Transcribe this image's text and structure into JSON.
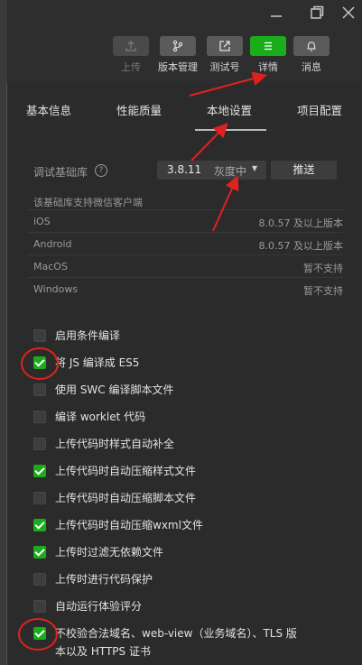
{
  "window": {
    "minimize_icon": "minimize-icon",
    "maximize_icon": "maximize-icon",
    "close_icon": "close-icon"
  },
  "toolbar": {
    "upload": "上传",
    "version": "版本管理",
    "test": "测试号",
    "detail": "详情",
    "message": "消息",
    "accent": "#1aad19"
  },
  "tabs": [
    "基本信息",
    "性能质量",
    "本地设置",
    "项目配置"
  ],
  "debug_lib": {
    "label": "调试基础库",
    "help": "?",
    "version": "3.8.11",
    "status": "灰度中",
    "push": "推送",
    "support_note": "该基础库支持微信客户端",
    "platforms": [
      {
        "name": "iOS",
        "value": "8.0.57 及以上版本"
      },
      {
        "name": "Android",
        "value": "8.0.57 及以上版本"
      },
      {
        "name": "MacOS",
        "value": "暂不支持"
      },
      {
        "name": "Windows",
        "value": "暂不支持"
      }
    ]
  },
  "options": [
    {
      "label": "启用条件编译",
      "checked": false
    },
    {
      "label": "将 JS 编译成 ES5",
      "checked": true
    },
    {
      "label": "使用 SWC 编译脚本文件",
      "checked": false
    },
    {
      "label": "编译 worklet 代码",
      "checked": false
    },
    {
      "label": "上传代码时样式自动补全",
      "checked": false
    },
    {
      "label": "上传代码时自动压缩样式文件",
      "checked": true
    },
    {
      "label": "上传代码时自动压缩脚本文件",
      "checked": false
    },
    {
      "label": "上传代码时自动压缩wxml文件",
      "checked": true
    },
    {
      "label": "上传时过滤无依赖文件",
      "checked": true
    },
    {
      "label": "上传时进行代码保护",
      "checked": false
    },
    {
      "label": "自动运行体验评分",
      "checked": false
    },
    {
      "label": "不校验合法域名、web-view（业务域名）、TLS 版",
      "label2": "本以及 HTTPS 证书",
      "checked": true
    }
  ]
}
